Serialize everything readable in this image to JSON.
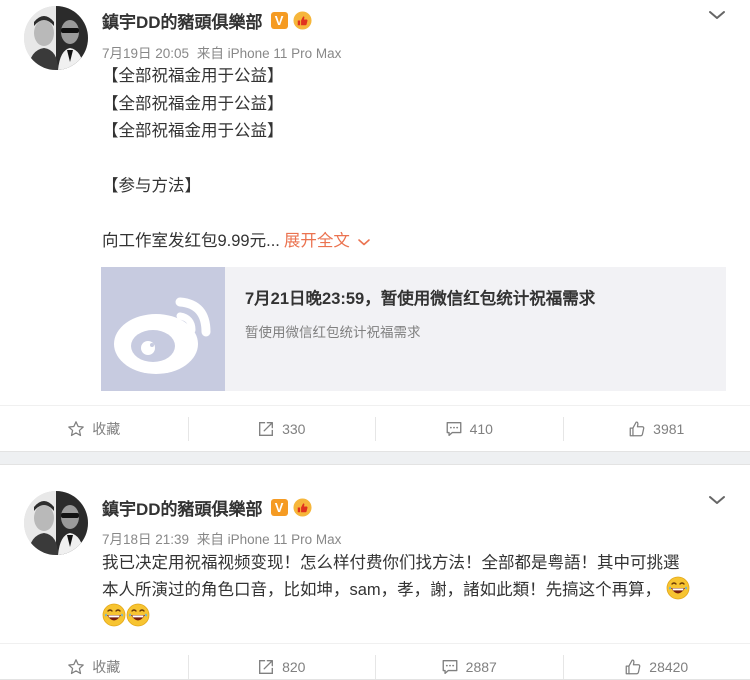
{
  "posts": [
    {
      "username": "鎮宇DD的豬頭俱樂部",
      "verified_badge": "V",
      "timestamp": "7月19日 20:05",
      "source": "来自 iPhone 11 Pro Max",
      "lines": [
        "【全部祝福金用于公益】",
        "【全部祝福金用于公益】",
        "【全部祝福金用于公益】",
        "",
        "【参与方法】",
        ""
      ],
      "last_line": "向工作室发红包9.99元...",
      "expand_label": "展开全文",
      "link_card": {
        "title": "7月21日晚23:59，暂使用微信红包统计祝福需求",
        "subtitle": "暂使用微信红包统计祝福需求"
      },
      "actions": {
        "favorite": "收藏",
        "repost": "330",
        "comment": "410",
        "like": "3981"
      }
    },
    {
      "username": "鎮宇DD的豬頭俱樂部",
      "verified_badge": "V",
      "timestamp": "7月18日 21:39",
      "source": "来自 iPhone 11 Pro Max",
      "line1": "我已决定用祝福视频变现！怎么样付费你们找方法！全部都是粤語！其中可挑選",
      "line2": "本人所演过的角色口音，比如坤，sam，孝，謝，諸如此類！先搞这个再算，",
      "actions": {
        "favorite": "收藏",
        "repost": "820",
        "comment": "2887",
        "like": "28420"
      }
    }
  ],
  "colors": {
    "accent_link": "#eb7350",
    "verified": "#f59b23",
    "meta_text": "#888888"
  }
}
